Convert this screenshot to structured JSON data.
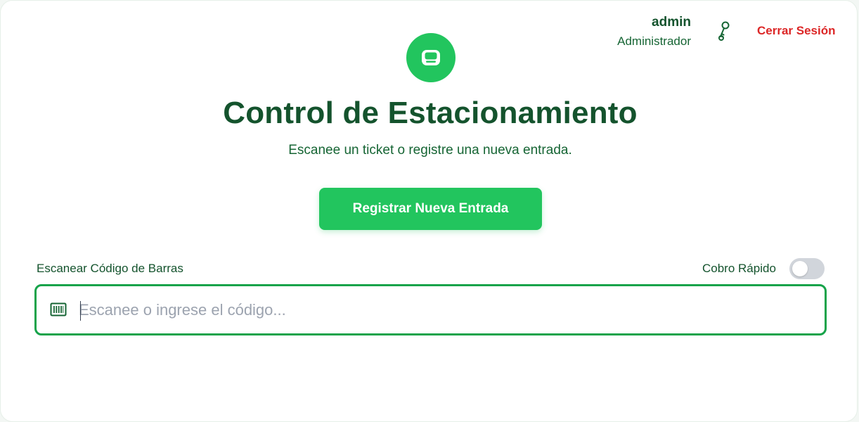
{
  "header": {
    "user_name": "admin",
    "user_role": "Administrador",
    "key_icon": "key-icon",
    "logout_label": "Cerrar Sesión"
  },
  "hero": {
    "logo_icon": "car-icon",
    "title": "Control de Estacionamiento",
    "subtitle": "Escanee un ticket o registre una nueva entrada.",
    "primary_button": "Registrar Nueva Entrada"
  },
  "scan": {
    "label": "Escanear Código de Barras",
    "quick_charge_label": "Cobro Rápido",
    "quick_charge_enabled": false,
    "barcode_icon": "barcode-icon",
    "input_value": "",
    "input_placeholder": "Escanee o ingrese el código..."
  },
  "colors": {
    "accent": "#22c55e",
    "accent_dark": "#16a34a",
    "text_dark": "#14532d",
    "danger": "#dc2626",
    "toggle_off": "#d1d5db"
  }
}
